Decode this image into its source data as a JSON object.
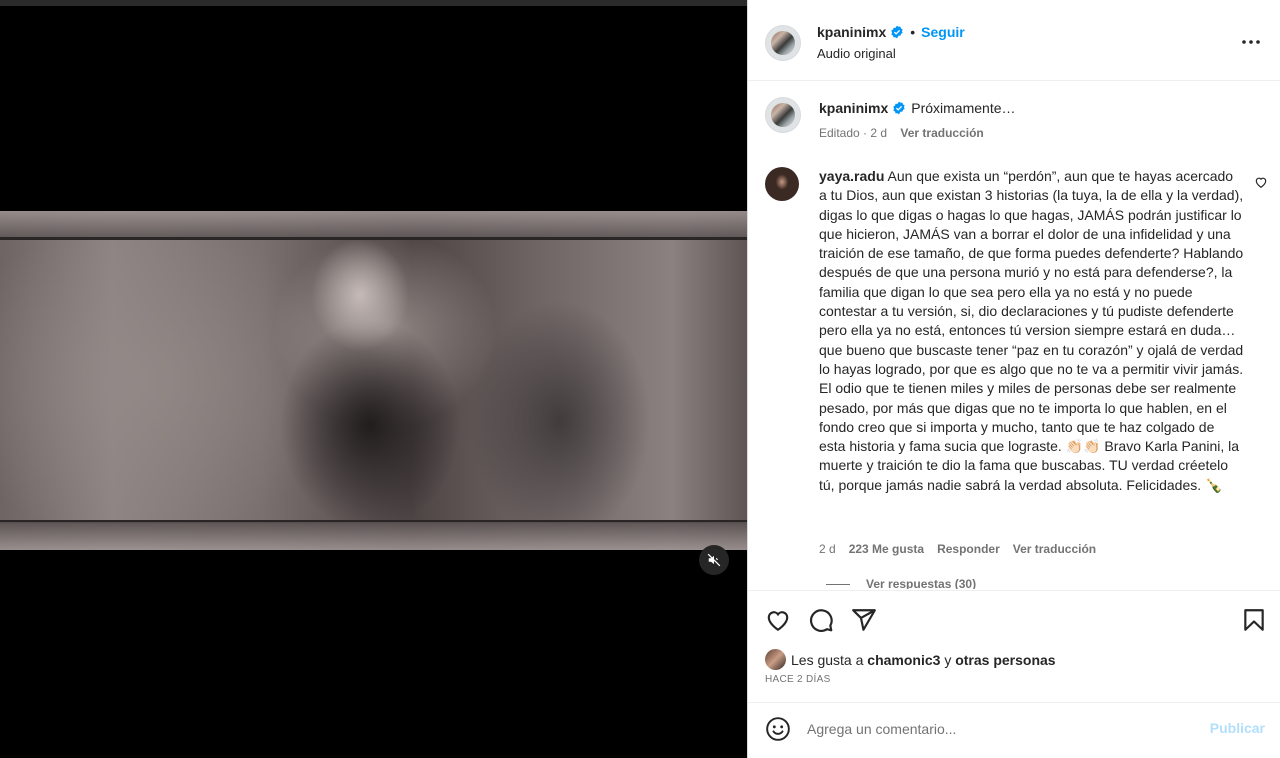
{
  "header": {
    "username": "kpaninimx",
    "follow_label": "Seguir",
    "dot": "•",
    "subtitle": "Audio original"
  },
  "caption": {
    "username": "kpaninimx",
    "text": "Próximamente…",
    "edited": "Editado · 2 d",
    "translate": "Ver traducción"
  },
  "comment": {
    "username": "yaya.radu",
    "text": "Aun que exista un “perdón”, aun que te hayas acercado a tu Dios, aun que existan 3 historias (la tuya, la de ella y la verdad), digas lo que digas o hagas lo que hagas, JAMÁS podrán justificar lo que hicieron, JAMÁS van a borrar el dolor de una infidelidad y una traición de ese tamaño, de que forma puedes defenderte? Hablando después de que una persona murió y no está para defenderse?, la familia que digan lo que sea pero ella ya no está y no puede contestar a tu versión, si, dio declaraciones y tú pudiste defenderte pero ella ya no está, entonces tú version siempre estará en duda… que bueno que buscaste tener “paz en tu corazón” y ojalá de verdad lo hayas logrado, por que es algo que no te va a permitir vivir jamás. El odio que te tienen miles y miles de personas debe ser realmente pesado, por más que digas que no te importa lo que hablen, en el fondo creo que si importa y mucho, tanto que te haz colgado de esta historia y fama sucia que lograste. 👏🏻👏🏻 Bravo Karla Panini, la muerte y traición te dio la fama que buscabas. TU verdad créetelo tú, porque jamás nadie sabrá la verdad absoluta. Felicidades. 🍾",
    "time": "2 d",
    "likes": "223 Me gusta",
    "reply": "Responder",
    "translate": "Ver traducción",
    "view_replies": "Ver respuestas (30)"
  },
  "likes": {
    "prefix": "Les gusta a",
    "user": "chamonic3",
    "conj": "y",
    "others": "otras personas"
  },
  "timeago": "HACE 2 DÍAS",
  "compose": {
    "placeholder": "Agrega un comentario...",
    "publish": "Publicar"
  },
  "colors": {
    "link_blue": "#0095f6",
    "verified_blue": "#0095f6",
    "publish_disabled": "#b2dffc",
    "muted_text": "#737373"
  },
  "icons": [
    "more-icon",
    "verified-icon",
    "heart-icon",
    "comment-icon",
    "share-icon",
    "bookmark-icon",
    "emoji-icon",
    "mute-icon"
  ]
}
